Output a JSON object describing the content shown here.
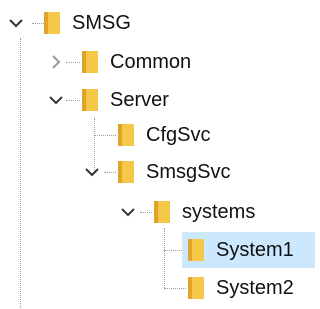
{
  "tree": {
    "root": {
      "label": "SMSG",
      "icon": "folder-icon",
      "expanded": true,
      "children": [
        {
          "label": "Common",
          "icon": "folder-icon",
          "expanded": false,
          "has_children": true
        },
        {
          "label": "Server",
          "icon": "folder-icon",
          "expanded": true,
          "children": [
            {
              "label": "CfgSvc",
              "icon": "folder-icon",
              "has_children": false
            },
            {
              "label": "SmsgSvc",
              "icon": "folder-icon",
              "expanded": true,
              "children": [
                {
                  "label": "systems",
                  "icon": "folder-icon",
                  "expanded": true,
                  "children": [
                    {
                      "label": "System1",
                      "icon": "folder-icon",
                      "selected": true
                    },
                    {
                      "label": "System2",
                      "icon": "folder-icon",
                      "selected": false
                    }
                  ]
                }
              ]
            }
          ]
        }
      ]
    }
  },
  "colors": {
    "selection": "#cce8ff",
    "folder_front": "#f6c84a",
    "folder_back": "#e0a42a",
    "connector": "#a0a0a0"
  }
}
